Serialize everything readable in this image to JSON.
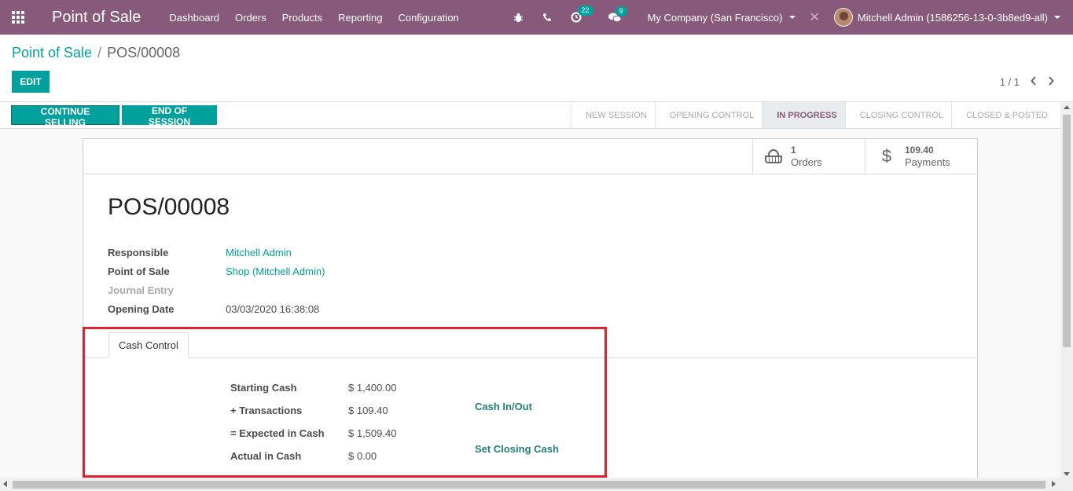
{
  "navbar": {
    "app_title": "Point of Sale",
    "menu": [
      "Dashboard",
      "Orders",
      "Products",
      "Reporting",
      "Configuration"
    ],
    "activity_badge": "22",
    "messages_badge": "9",
    "company": "My Company (San Francisco)",
    "user": "Mitchell Admin (1586256-13-0-3b8ed9-all)",
    "icons": [
      "apps-icon",
      "bug-icon",
      "phone-icon",
      "activity-icon",
      "chat-icon",
      "close-icon"
    ]
  },
  "breadcrumb": {
    "parent": "Point of Sale",
    "separator": "/",
    "current": "POS/00008"
  },
  "actions": {
    "edit": "EDIT",
    "pager": "1 / 1",
    "prev": "‹",
    "next": "›"
  },
  "statusbar": {
    "continue_selling": "CONTINUE SELLING",
    "end_of_session": "END OF SESSION",
    "stages": [
      "NEW SESSION",
      "OPENING CONTROL",
      "IN PROGRESS",
      "CLOSING CONTROL",
      "CLOSED & POSTED"
    ],
    "active_stage": "IN PROGRESS"
  },
  "smart_buttons": {
    "orders_count": "1",
    "orders_label": "Orders",
    "payments_amount": "109.40",
    "payments_label": "Payments",
    "payments_icon_glyph": "$"
  },
  "record": {
    "title": "POS/00008",
    "fields": {
      "responsible_label": "Responsible",
      "responsible_value": "Mitchell Admin",
      "pos_label": "Point of Sale",
      "pos_value": "Shop (Mitchell Admin)",
      "journal_label": "Journal Entry",
      "opening_label": "Opening Date",
      "opening_value": "03/03/2020 16:38:08"
    }
  },
  "notebook": {
    "tab": "Cash Control"
  },
  "cash_control": {
    "starting_label": "Starting Cash",
    "starting_value": "$ 1,400.00",
    "transactions_label": "+ Transactions",
    "transactions_value": "$ 109.40",
    "expected_label": "= Expected in Cash",
    "expected_value": "$ 1,509.40",
    "actual_label": "Actual in Cash",
    "actual_value": "$ 0.00",
    "cash_in_out": "Cash In/Out",
    "set_closing_cash": "Set Closing Cash"
  },
  "colors": {
    "navbar": "#875a7b",
    "primary": "#00a09d",
    "highlight": "#e3202b"
  }
}
